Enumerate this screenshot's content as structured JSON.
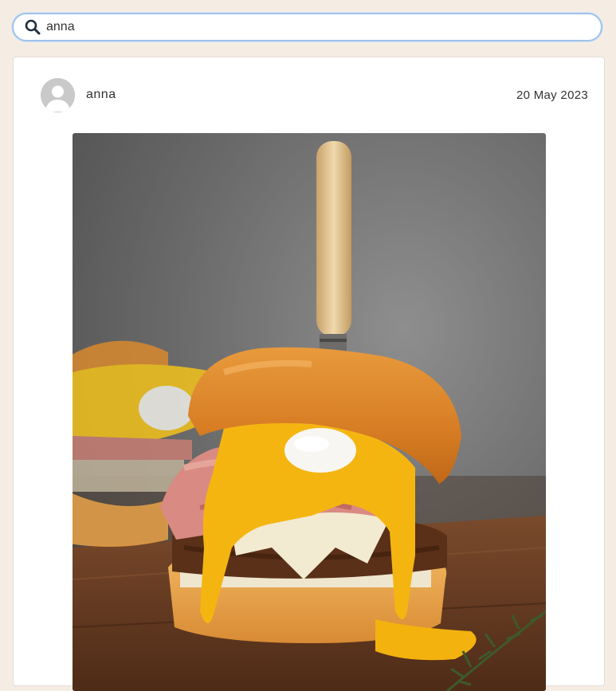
{
  "search": {
    "value": "anna",
    "icon": "search-icon"
  },
  "post": {
    "username": "anna",
    "date": "20 May 2023",
    "avatar_icon": "user-avatar-icon",
    "image_description": "burger-with-egg-photo"
  },
  "colors": {
    "page_background": "#f5ede4",
    "search_border": "#9ec3ea",
    "card_background": "#ffffff",
    "icon_color": "#1f2e3d"
  }
}
